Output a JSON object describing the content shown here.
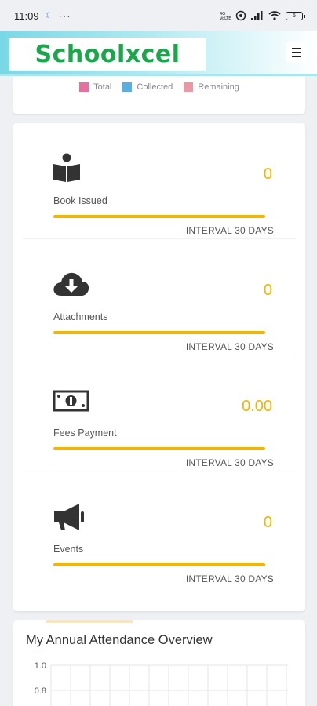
{
  "status_bar": {
    "time": "11:09",
    "dots": "···",
    "battery": "5"
  },
  "header": {
    "logo": "Schoolxcel",
    "menu_icon": "hamburger-menu-icon"
  },
  "legend": [
    {
      "label": "Total",
      "color": "#e870a0"
    },
    {
      "label": "Collected",
      "color": "#5aaee0"
    },
    {
      "label": "Remaining",
      "color": "#e79aa4"
    }
  ],
  "stats": [
    {
      "icon": "book-reader-icon",
      "label": "Book Issued",
      "value": "0",
      "interval": "INTERVAL 30 DAYS"
    },
    {
      "icon": "cloud-download-icon",
      "label": "Attachments",
      "value": "0",
      "interval": "INTERVAL 30 DAYS"
    },
    {
      "icon": "money-bill-icon",
      "label": "Fees Payment",
      "value": "0.00",
      "interval": "INTERVAL 30 DAYS"
    },
    {
      "icon": "megaphone-icon",
      "label": "Events",
      "value": "0",
      "interval": "INTERVAL 30 DAYS"
    }
  ],
  "attendance": {
    "title": "My Annual Attendance Overview",
    "y_ticks": [
      "1.0",
      "0.8"
    ]
  },
  "colors": {
    "accent": "#f4b400",
    "brand": "#17a84a"
  }
}
